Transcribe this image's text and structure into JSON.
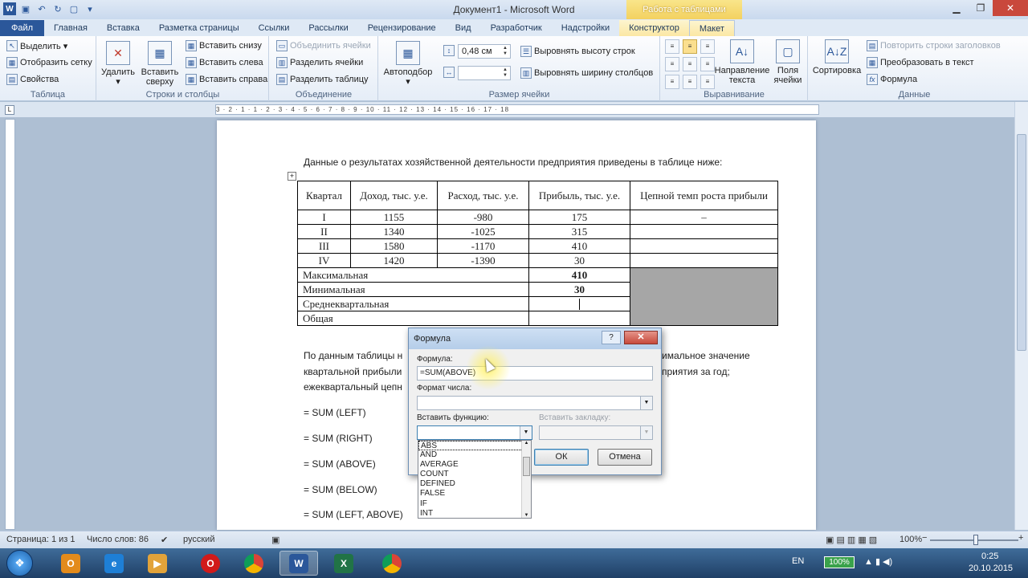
{
  "window": {
    "title": "Документ1 - Microsoft Word",
    "context_header": "Работа с таблицами"
  },
  "tabs": [
    "Файл",
    "Главная",
    "Вставка",
    "Разметка страницы",
    "Ссылки",
    "Рассылки",
    "Рецензирование",
    "Вид",
    "Разработчик",
    "Надстройки",
    "Конструктор",
    "Макет"
  ],
  "ribbon": {
    "table": {
      "label": "Таблица",
      "select": "Выделить ▾",
      "show_grid": "Отобразить сетку",
      "properties": "Свойства"
    },
    "rows_cols": {
      "label": "Строки и столбцы",
      "delete": "Удалить",
      "insert_above_1": "Вставить",
      "insert_above_2": "сверху",
      "insert_below": "Вставить снизу",
      "insert_left": "Вставить слева",
      "insert_right": "Вставить справа"
    },
    "merge": {
      "label": "Объединение",
      "merge_cells": "Объединить ячейки",
      "split_cells": "Разделить ячейки",
      "split_table": "Разделить таблицу"
    },
    "cell_size": {
      "label": "Размер ячейки",
      "autofit": "Автоподбор",
      "height_value": "0,48 см",
      "width_value": "",
      "distribute_rows": "Выровнять высоту строк",
      "distribute_cols": "Выровнять ширину столбцов"
    },
    "alignment": {
      "label": "Выравнивание",
      "direction_1": "Направление",
      "direction_2": "текста",
      "margins_1": "Поля",
      "margins_2": "ячейки"
    },
    "data": {
      "label": "Данные",
      "sort": "Сортировка",
      "repeat_header": "Повторить строки заголовков",
      "convert": "Преобразовать в текст",
      "formula": "Формула"
    }
  },
  "ruler": "3 · 2 · 1 · 1 · 2 · 3 · 4 · 5 · 6 · 7 · 8 · 9 · 10 · 11 · 12 · 13 · 14 · 15 · 16 · 17 · 18",
  "document": {
    "intro": "Данные о результатах хозяйственной деятельности предприятия приведены в таблице ниже:",
    "table": {
      "headers": [
        "Квартал",
        "Доход, тыс. у.е.",
        "Расход, тыс. у.е.",
        "Прибыль, тыс. у.е.",
        "Цепной темп роста прибыли"
      ],
      "rows": [
        [
          "I",
          "1155",
          "-980",
          "175",
          "–"
        ],
        [
          "II",
          "1340",
          "-1025",
          "315",
          ""
        ],
        [
          "III",
          "1580",
          "-1170",
          "410",
          ""
        ],
        [
          "IV",
          "1420",
          "-1390",
          "30",
          ""
        ]
      ],
      "summary": [
        {
          "label": "Максимальная",
          "value": "410"
        },
        {
          "label": "Минимальная",
          "value": "30"
        },
        {
          "label": "Среднеквартальная",
          "value": ""
        },
        {
          "label": "Общая",
          "value": ""
        }
      ]
    },
    "para_line1_start": "По данным таблицы н",
    "para_line1_end": "имальное значение",
    "para_line2_start": "квартальной прибыли",
    "para_line2_end": "приятия за год;",
    "para_line3_start": "ежеквартальный цепн",
    "formulas": [
      "= SUM (LEFT)",
      "= SUM (RIGHT)",
      "= SUM (ABOVE)",
      "= SUM (BELOW)",
      "= SUM (LEFT, ABOVE)"
    ]
  },
  "dialog": {
    "title": "Формула",
    "help": "?",
    "close": "✕",
    "formula_label": "Формула:",
    "formula_value": "=SUM(ABOVE)",
    "number_format_label": "Формат числа:",
    "insert_function_label": "Вставить функцию:",
    "insert_bookmark_label": "Вставить закладку:",
    "ok": "ОК",
    "cancel": "Отмена",
    "functions": [
      "ABS",
      "AND",
      "AVERAGE",
      "COUNT",
      "DEFINED",
      "FALSE",
      "IF",
      "INT"
    ]
  },
  "status": {
    "page": "Страница: 1 из 1",
    "words": "Число слов: 86",
    "language": "русский",
    "zoom": "100%"
  },
  "taskbar": {
    "lang": "EN",
    "battery": "100%",
    "time": "0:25",
    "date": "20.10.2015"
  }
}
